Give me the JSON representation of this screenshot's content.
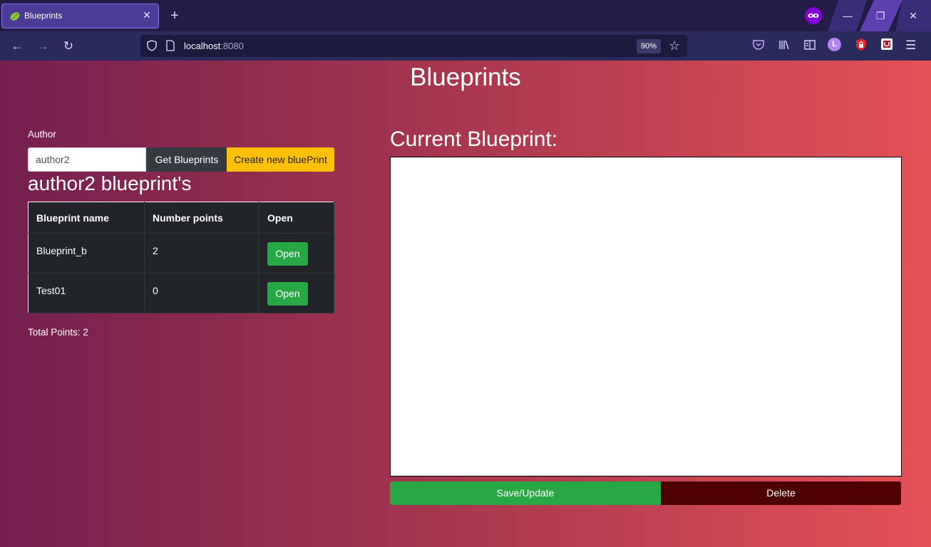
{
  "browser": {
    "tab_title": "Blueprints",
    "url_host": "localhost",
    "url_port": ":8080",
    "zoom": "90%",
    "icons": {
      "back": "arrow-left-icon",
      "forward": "arrow-right-icon",
      "reload": "reload-icon",
      "new_tab": "plus-icon",
      "close_tab": "close-icon",
      "shield": "shield-icon",
      "page": "page-icon",
      "bookmark": "star-icon",
      "pocket": "pocket-icon",
      "library": "library-icon",
      "reader": "reader-view-icon",
      "account": "account-avatar-icon",
      "extension1": "lock-extension-icon",
      "extension2": "ublock-icon",
      "menu": "hamburger-menu-icon",
      "private": "private-mask-icon"
    },
    "account_initial": "L"
  },
  "page": {
    "title": "Blueprints",
    "author_label": "Author",
    "author_value": "author2",
    "get_button": "Get Blueprints",
    "create_button": "Create new bluePrint",
    "list_heading": "author2 blueprint's",
    "table": {
      "headers": [
        "Blueprint name",
        "Number points",
        "Open"
      ],
      "rows": [
        {
          "name": "Blueprint_b",
          "points": "2",
          "action": "Open"
        },
        {
          "name": "Test01",
          "points": "0",
          "action": "Open"
        }
      ]
    },
    "total_points": "Total Points: 2",
    "current_heading": "Current Blueprint:",
    "save_button": "Save/Update",
    "delete_button": "Delete"
  },
  "colors": {
    "gradient_start": "#741f4f",
    "gradient_end": "#e55156",
    "success": "#28a745",
    "warning": "#ffc107",
    "dark": "#343a40",
    "danger_dark": "#4e0000"
  }
}
